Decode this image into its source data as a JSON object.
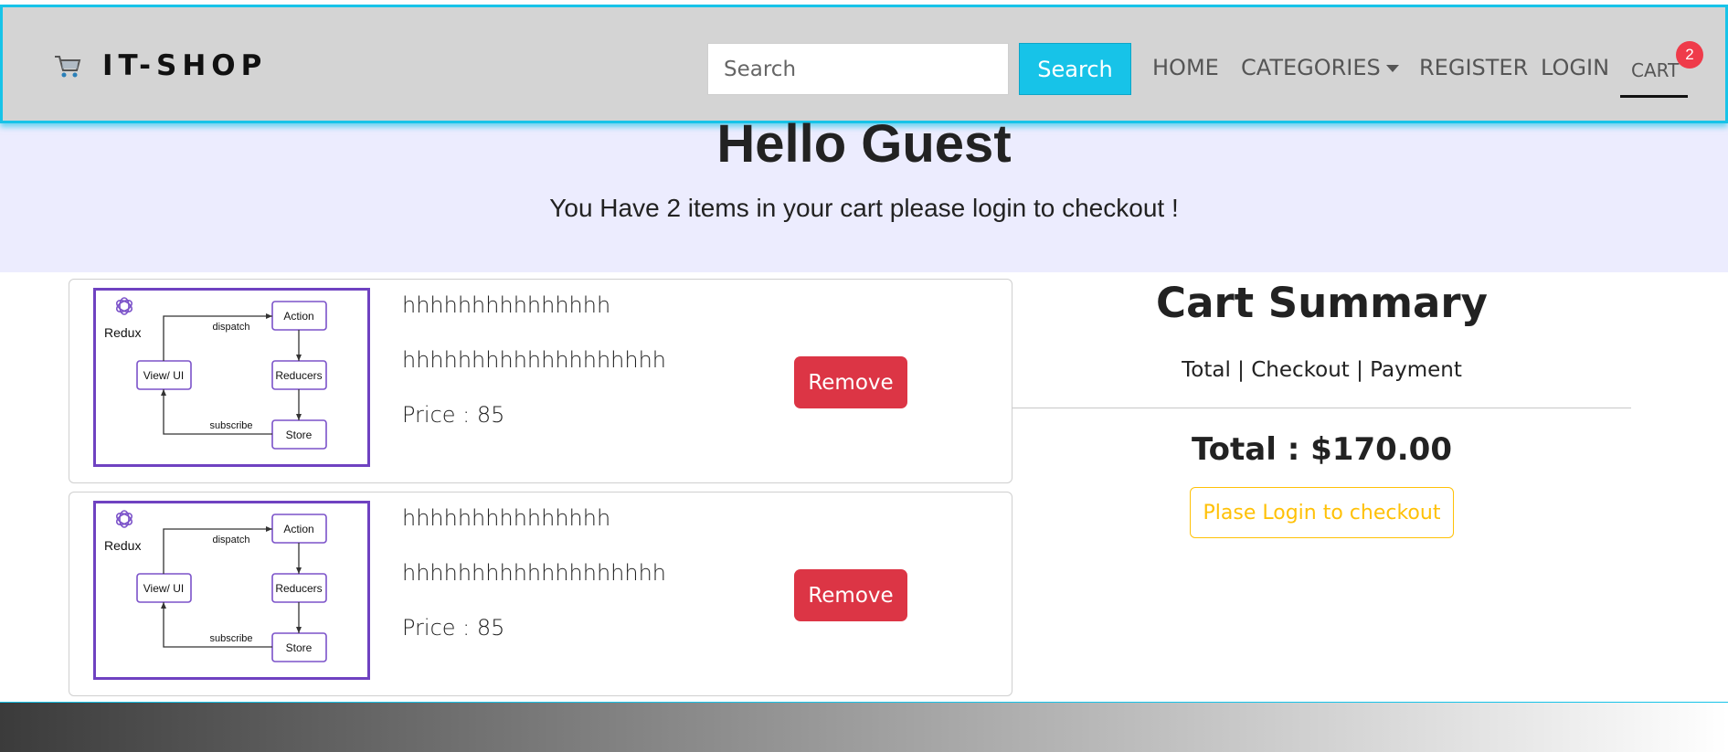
{
  "navbar": {
    "brand": "IT-SHOP",
    "brand_icon": "cart-icon",
    "search_placeholder": "Search",
    "search_button": "Search",
    "links": {
      "home": "HOME",
      "categories": "CATEGORIES",
      "register": "REGISTER",
      "login": "LOGIN",
      "cart": "CART"
    },
    "cart_count": "2"
  },
  "hero": {
    "title": "Hello Guest",
    "subtitle": "You Have 2 items in your cart please login to checkout !"
  },
  "cart_items": [
    {
      "image_alt": "Redux diagram",
      "name": "hhhhhhhhhhhhhhh",
      "description": "hhhhhhhhhhhhhhhhhhh",
      "price_label": "Price : ",
      "price": "85",
      "remove_label": "Remove"
    },
    {
      "image_alt": "Redux diagram",
      "name": "hhhhhhhhhhhhhhh",
      "description": "hhhhhhhhhhhhhhhhhhh",
      "price_label": "Price : ",
      "price": "85",
      "remove_label": "Remove"
    }
  ],
  "diagram": {
    "logo_text": "Redux",
    "view": "View/ UI",
    "action": "Action",
    "reducers": "Reducers",
    "store": "Store",
    "dispatch": "dispatch",
    "subscribe": "subscribe"
  },
  "summary": {
    "title": "Cart Summary",
    "subtitle": "Total | Checkout | Payment",
    "total": "Total : $170.00",
    "login_button": "Plase Login to checkout"
  },
  "colors": {
    "accent": "#17c3e8",
    "danger": "#dc3545",
    "warning": "#ffc107",
    "badge": "#ef3b4a",
    "hero_bg": "#ececfe",
    "navbar_bg": "#d4d4d4",
    "diagram_purple": "#6f42c1"
  }
}
